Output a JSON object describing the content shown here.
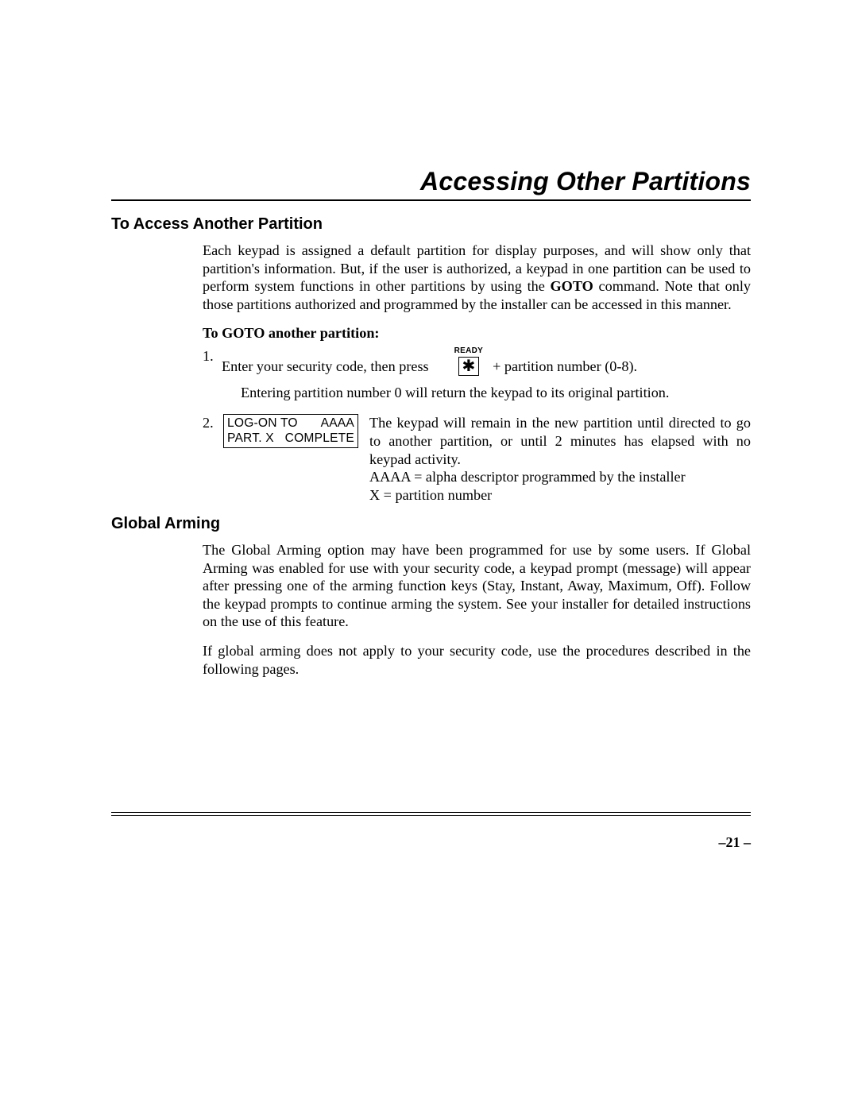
{
  "title": "Accessing Other Partitions",
  "section1": {
    "heading": "To Access Another Partition",
    "para1_pre": "Each keypad is assigned a default partition for display purposes, and will show only that partition's information. But, if the user is authorized, a keypad in one partition can be used to perform system functions in other partitions by using the ",
    "goto_bold": "GOTO",
    "para1_post": " command. Note that only those partitions authorized and programmed by the installer can be accessed in this manner.",
    "subheading": "To GOTO another partition:",
    "step1": {
      "num": "1.",
      "lead": "Enter your security code, then press",
      "keylabel": "READY",
      "keyglyph": "✱",
      "trail": "+ partition number (0-8).",
      "note": "Entering partition number 0 will return the keypad to its original partition."
    },
    "step2": {
      "num": "2.",
      "lcd": {
        "r1a": "LOG-ON TO",
        "r1b": "AAAA",
        "r2a": "PART. X",
        "r2b": "COMPLETE"
      },
      "text_para": "The keypad will remain in the new partition until directed to go to another partition, or until 2 minutes has elapsed with no keypad activity.",
      "text_aaaa": "AAAA = alpha descriptor programmed by the installer",
      "text_x": "X = partition number"
    }
  },
  "section2": {
    "heading": "Global Arming",
    "para1": "The Global Arming option may have been programmed for use by some users. If Global Arming was enabled for use with your security code, a keypad prompt (message) will appear after pressing one of the arming function keys (Stay, Instant, Away, Maximum, Off). Follow the keypad prompts to continue arming the system. See your installer for detailed instructions on the use of this feature.",
    "para2": "If global arming does not apply to your security code, use the procedures described in the following pages."
  },
  "page_number": "–21 –"
}
